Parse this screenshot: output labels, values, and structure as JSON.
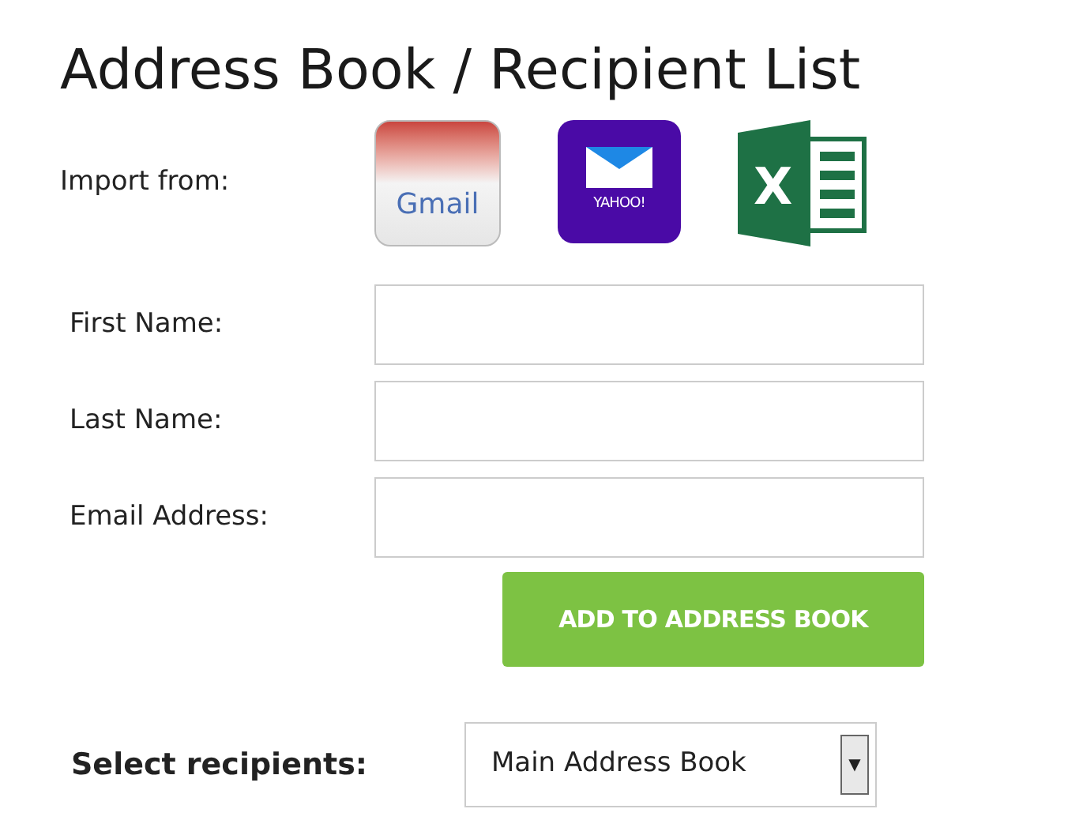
{
  "title": "Address Book / Recipient List",
  "import": {
    "label": "Import from:",
    "sources": [
      {
        "kind": "gmail",
        "text": "Gmail"
      },
      {
        "kind": "yahoo",
        "text": "YAHOO!"
      },
      {
        "kind": "excel",
        "text": "X"
      }
    ]
  },
  "fields": [
    {
      "label": "First Name:"
    },
    {
      "label": "Last Name:"
    },
    {
      "label": "Email Address:"
    }
  ],
  "add_button": "ADD TO ADDRESS BOOK",
  "recipients": {
    "label": "Select recipients:",
    "value": "Main Address Book",
    "arrow": "▼"
  }
}
